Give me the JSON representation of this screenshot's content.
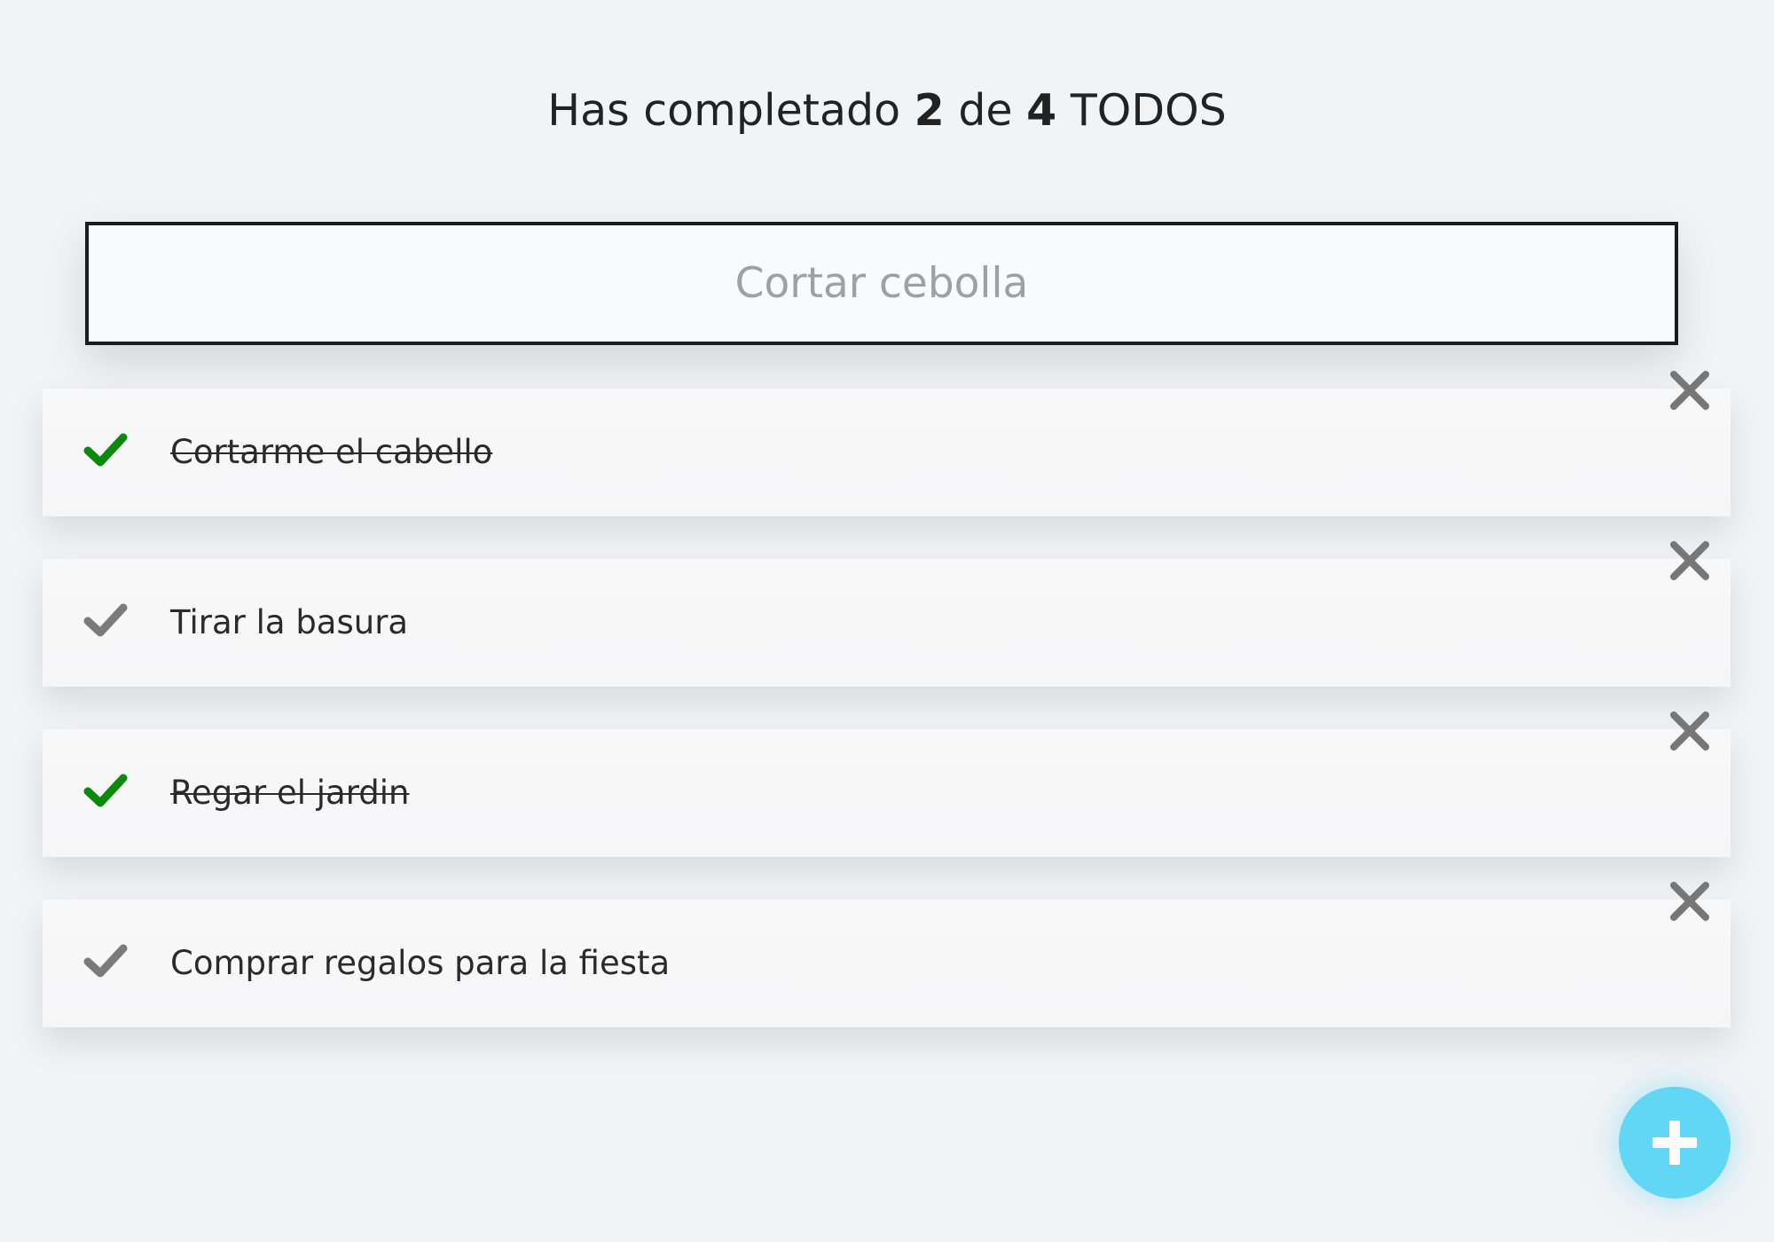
{
  "header": {
    "prefix": "Has completado",
    "completed": "2",
    "middle": "de",
    "total": "4",
    "suffix": "TODOS"
  },
  "new_task": {
    "placeholder": "Cortar cebolla",
    "value": ""
  },
  "todos": [
    {
      "text": "Cortarme el cabello",
      "completed": true
    },
    {
      "text": "Tirar la basura",
      "completed": false
    },
    {
      "text": "Regar el jardin",
      "completed": true
    },
    {
      "text": "Comprar regalos para la fiesta",
      "completed": false
    }
  ],
  "icons": {
    "check": "check-icon",
    "delete": "close-icon",
    "add": "plus-icon"
  },
  "colors": {
    "check_done": "#0a8a0a",
    "check_pending": "#7b7b7b",
    "delete": "#777777",
    "fab": "#61d6f5",
    "background": "#f2f3f5"
  }
}
